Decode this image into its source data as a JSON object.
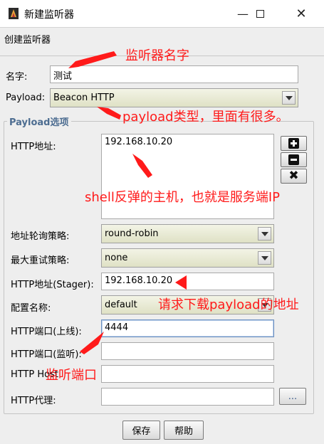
{
  "window": {
    "title": "新建监听器"
  },
  "header": {
    "text": "创建监听器"
  },
  "fields": {
    "name": {
      "label": "名字:",
      "value": "测试"
    },
    "payload": {
      "label": "Payload:",
      "value": "Beacon HTTP"
    }
  },
  "group": {
    "title": "Payload选项",
    "http_hosts": {
      "label": "HTTP地址:",
      "values": [
        "192.168.10.20"
      ]
    },
    "rotate": {
      "label": "地址轮询策略:",
      "value": "round-robin"
    },
    "max_retry": {
      "label": "最大重试策略:",
      "value": "none"
    },
    "host_stager": {
      "label": "HTTP地址(Stager):",
      "value": "192.168.10.20"
    },
    "profile": {
      "label": "配置名称:",
      "value": "default"
    },
    "port_c2": {
      "label": "HTTP端口(上线):",
      "value": "4444"
    },
    "port_bind": {
      "label": "HTTP端口(监听):",
      "value": ""
    },
    "host_header": {
      "label": "HTTP Host",
      "value": ""
    },
    "proxy": {
      "label": "HTTP代理:",
      "value": "",
      "browse_label": "..."
    }
  },
  "buttons": {
    "save": "保存",
    "help": "帮助"
  },
  "annotations": {
    "name": "监听器名字",
    "payload": "payload类型，里面有很多。",
    "host": "shell反弹的主机，也就是服务端IP",
    "stager": "请求下载payload的地址",
    "port": "监听端口"
  },
  "colors": {
    "annotation": "#ff1a1a",
    "group_title": "#4d6d91",
    "combo_bg": "#e8e9d3"
  },
  "icons": {
    "app": "cobalt-strike-icon",
    "minimize": "minimize-icon",
    "maximize": "maximize-icon",
    "close": "close-icon"
  }
}
